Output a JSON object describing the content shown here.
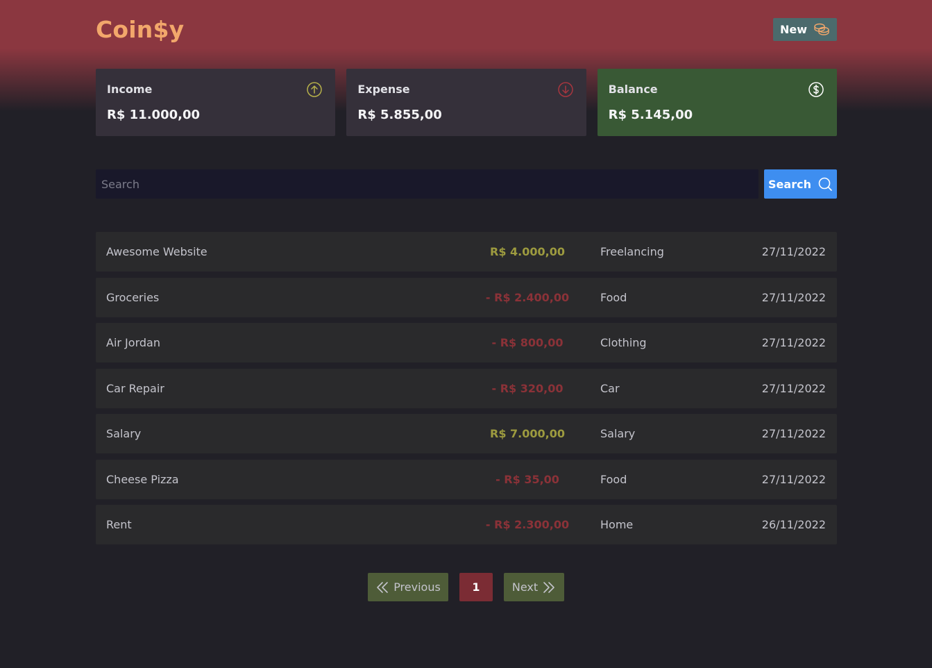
{
  "app": {
    "logo": "Coin$y"
  },
  "header": {
    "new_label": "New",
    "new_icon": "coins-icon"
  },
  "summary": {
    "income": {
      "label": "Income",
      "value": "R$ 11.000,00",
      "icon": "arrow-circle-up-icon",
      "icon_color": "#b6b04a"
    },
    "expense": {
      "label": "Expense",
      "value": "R$ 5.855,00",
      "icon": "arrow-circle-down-icon",
      "icon_color": "#a8363f"
    },
    "balance": {
      "label": "Balance",
      "value": "R$ 5.145,00",
      "icon": "currency-circle-dollar-icon",
      "icon_color": "#ffffff"
    }
  },
  "search": {
    "placeholder": "Search",
    "value": "",
    "button_label": "Search"
  },
  "transactions": [
    {
      "description": "Awesome Website",
      "amount": "R$ 4.000,00",
      "type": "income",
      "category": "Freelancing",
      "date": "27/11/2022"
    },
    {
      "description": "Groceries",
      "amount": "- R$ 2.400,00",
      "type": "outcome",
      "category": "Food",
      "date": "27/11/2022"
    },
    {
      "description": "Air Jordan",
      "amount": "- R$ 800,00",
      "type": "outcome",
      "category": "Clothing",
      "date": "27/11/2022"
    },
    {
      "description": "Car Repair",
      "amount": "- R$ 320,00",
      "type": "outcome",
      "category": "Car",
      "date": "27/11/2022"
    },
    {
      "description": "Salary",
      "amount": "R$ 7.000,00",
      "type": "income",
      "category": "Salary",
      "date": "27/11/2022"
    },
    {
      "description": "Cheese Pizza",
      "amount": "- R$ 35,00",
      "type": "outcome",
      "category": "Food",
      "date": "27/11/2022"
    },
    {
      "description": "Rent",
      "amount": "- R$ 2.300,00",
      "type": "outcome",
      "category": "Home",
      "date": "26/11/2022"
    }
  ],
  "pagination": {
    "previous_label": "Previous",
    "current_page": "1",
    "next_label": "Next"
  },
  "colors": {
    "accent": "#f2a76b",
    "header_bg": "#8b3740",
    "background": "#212027",
    "income": "#9d9b3f",
    "outcome": "#8b3238",
    "balance_card": "#395935",
    "search_button": "#3e8ef0",
    "new_button": "#4b6a6c",
    "pager_button": "#4e5c38",
    "pager_active": "#7b2c34"
  }
}
